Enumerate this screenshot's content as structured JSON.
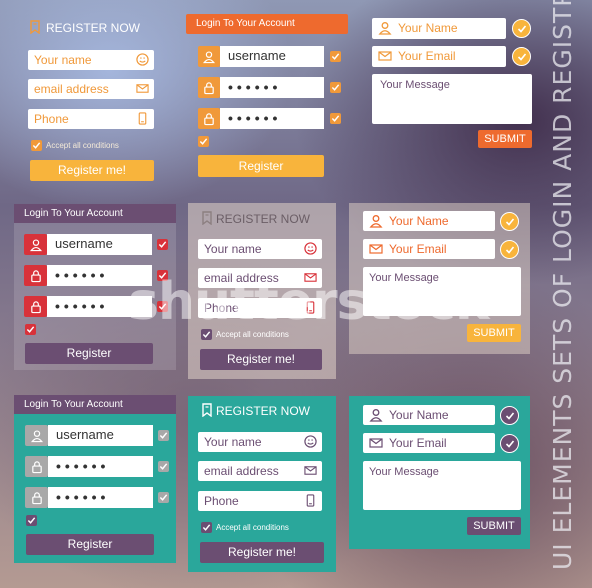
{
  "colors": {
    "orange": "#f0993a",
    "orange_dark": "#ee6a2e",
    "purple": "#6b4e72",
    "teal": "#2aa79b",
    "red": "#d8323a",
    "gray": "#a8a8a8",
    "yellow_btn": "#f8b43c"
  },
  "register_forms": [
    {
      "title": "REGISTER NOW",
      "name_placeholder": "Your name",
      "email_placeholder": "email address",
      "phone_placeholder": "Phone",
      "accept_label": "Accept all conditions",
      "button_label": "Register me!"
    },
    {
      "title": "REGISTER NOW",
      "name_placeholder": "Your name",
      "email_placeholder": "email address",
      "phone_placeholder": "Phone",
      "accept_label": "Accept all conditions",
      "button_label": "Register me!"
    },
    {
      "title": "REGISTER NOW",
      "name_placeholder": "Your name",
      "email_placeholder": "email address",
      "phone_placeholder": "Phone",
      "accept_label": "Accept all conditions",
      "button_label": "Register me!"
    }
  ],
  "login_forms": [
    {
      "title": "Login To Your Account",
      "username": "username",
      "password1": "••••••",
      "password2": "••••••",
      "button_label": "Register"
    },
    {
      "title": "Login To Your Account",
      "username": "username",
      "password1": "••••••",
      "password2": "••••••",
      "button_label": "Register"
    },
    {
      "title": "Login To Your Account",
      "username": "username",
      "password1": "••••••",
      "password2": "••••••",
      "button_label": "Register"
    }
  ],
  "contact_forms": [
    {
      "name_placeholder": "Your Name",
      "email_placeholder": "Your Email",
      "message_placeholder": "Your Message",
      "button_label": "SUBMIT"
    },
    {
      "name_placeholder": "Your Name",
      "email_placeholder": "Your Email",
      "message_placeholder": "Your Message",
      "button_label": "SUBMIT"
    },
    {
      "name_placeholder": "Your Name",
      "email_placeholder": "Your Email",
      "message_placeholder": "Your Message",
      "button_label": "SUBMIT"
    }
  ],
  "side_title": "UI ELEMENTS SETS OF LOGIN AND REGISTRATION",
  "watermark": "shutterstock"
}
